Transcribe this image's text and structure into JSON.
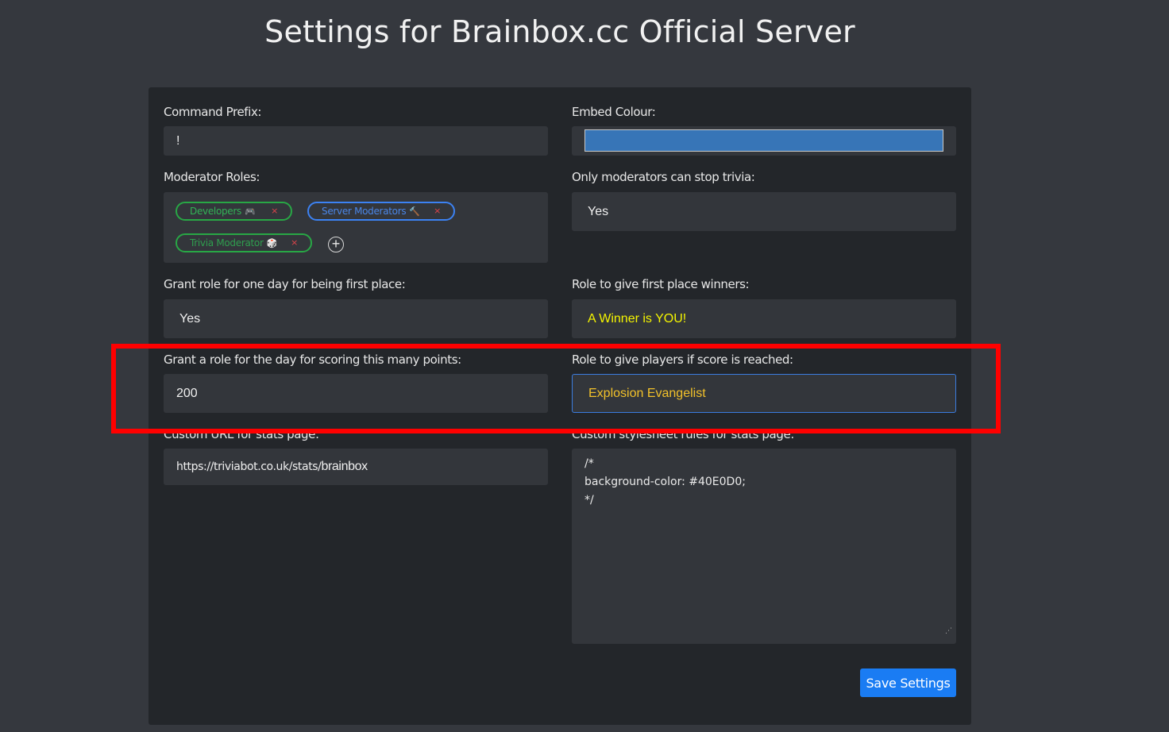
{
  "page": {
    "title": "Settings for Brainbox.cc Official Server"
  },
  "colors": {
    "background": "#35383e",
    "card": "#23262a",
    "input": "#33363b",
    "embed_colour": "#3775b7",
    "chip_green": "#28a745",
    "chip_blue": "#3c82f3",
    "winner_text": "#f5f500",
    "evangelist_text": "#f2c12a",
    "save_button": "#1a7cf3",
    "highlight": "#ff0000"
  },
  "settings": {
    "prefix": {
      "label": "Command Prefix:",
      "value": "!"
    },
    "embed": {
      "label": "Embed Colour:"
    },
    "moderators": {
      "label": "Moderator Roles:",
      "roles": [
        {
          "name": "Developers",
          "icon": "🎮"
        },
        {
          "name": "Server Moderators",
          "icon": "🔨"
        },
        {
          "name": "Trivia Moderator",
          "icon": "🎲"
        }
      ],
      "remove_glyph": "×",
      "add_glyph": "+"
    },
    "only_mods": {
      "label": "Only moderators can stop trivia:",
      "value": "Yes"
    },
    "first_place_grant": {
      "label": "Grant role for one day for being first place:",
      "value": "Yes"
    },
    "first_place_role": {
      "label": "Role to give first place winners:",
      "value": "A Winner is YOU!"
    },
    "points_threshold": {
      "label": "Grant a role for the day for scoring this many points:",
      "value": "200"
    },
    "score_role": {
      "label": "Role to give players if score is reached:",
      "value": "Explosion Evangelist"
    },
    "custom_url": {
      "label": "Custom URL for stats page:",
      "prefix": "https://triviabot.co.uk/stats/",
      "value": "brainbox"
    },
    "stylesheet": {
      "label": "Custom stylesheet rules for stats page:",
      "value": "/*\nbackground-color: #40E0D0;\n*/"
    }
  },
  "actions": {
    "save_label": "Save Settings"
  }
}
